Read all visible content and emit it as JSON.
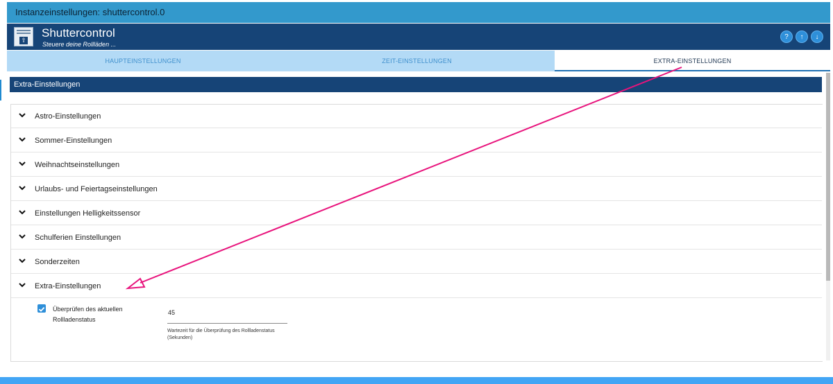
{
  "window": {
    "title": "Instanzeinstellungen: shuttercontrol.0"
  },
  "header": {
    "app_name": "Shuttercontrol",
    "subtitle": "Steuere deine Rollläden ...",
    "logo_icon": "shutter-logo-icon",
    "buttons": [
      {
        "icon": "help-icon",
        "glyph": "?"
      },
      {
        "icon": "upload-icon",
        "glyph": "↑"
      },
      {
        "icon": "download-icon",
        "glyph": "↓"
      }
    ]
  },
  "tabs": [
    {
      "label": "HAUPTEINSTELLUNGEN",
      "active": false
    },
    {
      "label": "ZEIT-EINSTELLUNGEN",
      "active": false
    },
    {
      "label": "EXTRA-EINSTELLUNGEN",
      "active": true
    }
  ],
  "section": {
    "title": "Extra-Einstellungen"
  },
  "accordion": {
    "items": [
      {
        "label": "Astro-Einstellungen",
        "expanded": false
      },
      {
        "label": "Sommer-Einstellungen",
        "expanded": false
      },
      {
        "label": "Weihnachtseinstellungen",
        "expanded": false
      },
      {
        "label": "Urlaubs- und Feiertagseinstellungen",
        "expanded": false
      },
      {
        "label": "Einstellungen Helligkeitssensor",
        "expanded": false
      },
      {
        "label": "Schulferien Einstellungen",
        "expanded": false
      },
      {
        "label": "Sonderzeiten",
        "expanded": false
      },
      {
        "label": "Extra-Einstellungen",
        "expanded": true
      }
    ]
  },
  "extra": {
    "check_status": {
      "checked": true,
      "label": "Überprüfen des aktuellen Rollladenstatus"
    },
    "wait_time": {
      "value": "45",
      "help": "Wartezeit für die Überprüfung des Rollladenstatus (Sekunden)"
    }
  },
  "colors": {
    "title_bar": "#3399cc",
    "header": "#164477",
    "tabs": "#b3daf6",
    "accent": "#2e8fd9",
    "annotation_arrow": "#e8137c"
  }
}
